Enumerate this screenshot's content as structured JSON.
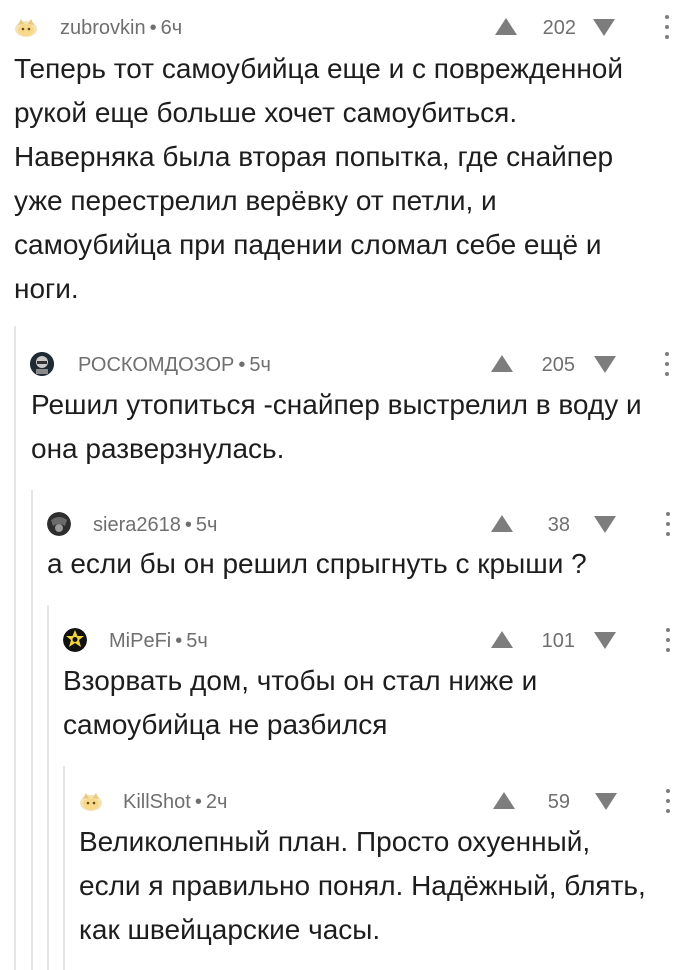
{
  "comments": [
    {
      "username": "zubrovkin",
      "time": "6ч",
      "rating": "202",
      "avatar": "cat-avatar-icon",
      "text": "Теперь тот самоубийца еще и с поврежденной\nрукой еще больше хочет самоубиться.\nНаверняка была вторая попытка, где снайпер\nуже перестрелил верёвку от петли, и\nсамоубийца при падении сломал себе ещё и\nноги."
    },
    {
      "username": "РОСКОМДОЗОР",
      "time": "5ч",
      "rating": "205",
      "avatar": "roskomdozor-avatar-icon",
      "text": "Решил утопиться -снайпер выстрелил в воду и\nона разверзнулась."
    },
    {
      "username": "siera2618",
      "time": "5ч",
      "rating": "38",
      "avatar": "dark-avatar-icon",
      "text": "а если бы он решил спрыгнуть с крыши ?"
    },
    {
      "username": "MiPeFi",
      "time": "5ч",
      "rating": "101",
      "avatar": "yellow-badge-avatar-icon",
      "text": "Взорвать дом, чтобы он стал ниже и\nсамоубийца не разбился"
    },
    {
      "username": "KillShot",
      "time": "2ч",
      "rating": "59",
      "avatar": "cat-avatar-icon",
      "text": "Великолепный план. Просто охуенный,\nесли я правильно понял. Надёжный, блять,\nкак швейцарские часы."
    }
  ],
  "colors": {
    "meta": "#6f6f6f",
    "text": "#1d1d1d",
    "thread_line": "#e5e5e5",
    "vote_arrow": "#7d7d7d"
  }
}
